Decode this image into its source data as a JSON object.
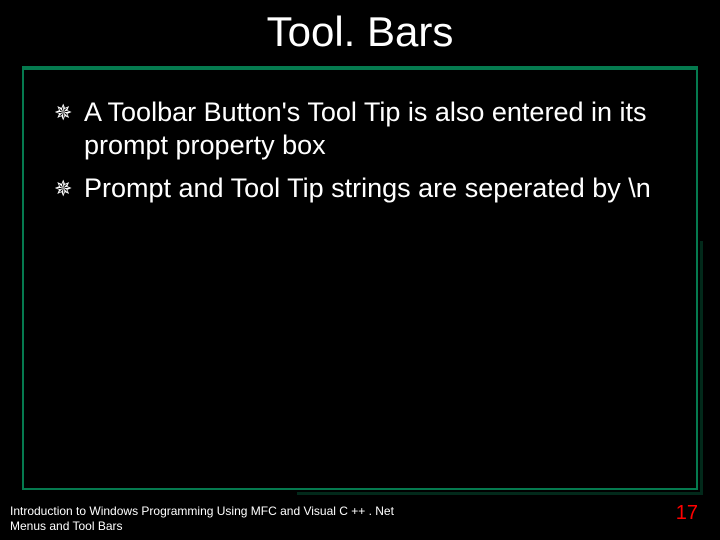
{
  "title": "Tool. Bars",
  "bullets": [
    "A Toolbar Button's Tool Tip is also entered in its prompt property box",
    "Prompt and Tool Tip strings are seperated by \\n"
  ],
  "footer": {
    "line1": "Introduction to Windows Programming Using MFC and Visual C ++ . Net",
    "line2": "Menus and Tool Bars"
  },
  "page_number": "17"
}
